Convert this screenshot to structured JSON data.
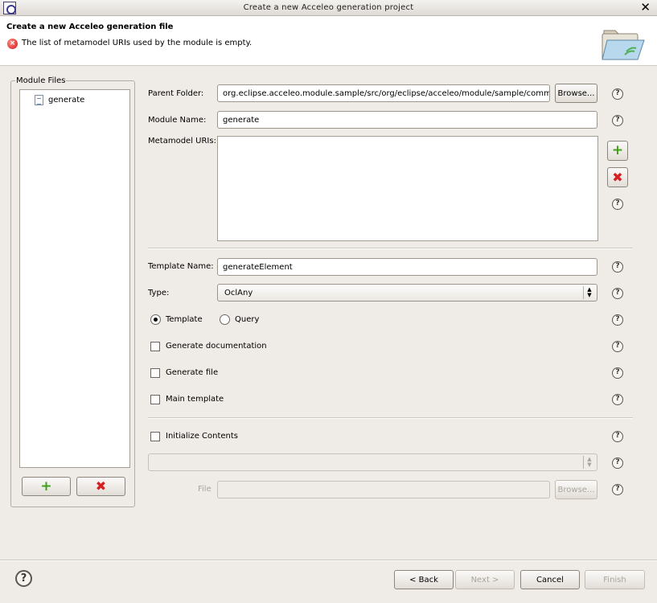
{
  "window": {
    "title": "Create a new Acceleo generation project"
  },
  "banner": {
    "heading": "Create a new Acceleo generation file",
    "error_message": "The list of metamodel URIs used by the module is empty."
  },
  "module_files": {
    "legend": "Module Files",
    "items": [
      {
        "label": "generate"
      }
    ]
  },
  "form": {
    "parent_folder": {
      "label": "Parent Folder:",
      "value": "org.eclipse.acceleo.module.sample/src/org/eclipse/acceleo/module/sample/common",
      "browse_label": "Browse..."
    },
    "module_name": {
      "label": "Module Name:",
      "value": "generate"
    },
    "metamodel_uris": {
      "label": "Metamodel URIs:"
    },
    "template_name": {
      "label": "Template Name:",
      "value": "generateElement"
    },
    "type": {
      "label": "Type:",
      "value": "OclAny"
    },
    "kind": {
      "template_label": "Template",
      "query_label": "Query",
      "selected": "Template"
    },
    "generate_documentation": {
      "label": "Generate documentation",
      "checked": false
    },
    "generate_file": {
      "label": "Generate file",
      "checked": false
    },
    "main_template": {
      "label": "Main template",
      "checked": false
    },
    "initialize_contents": {
      "label": "Initialize Contents",
      "checked": false,
      "combo_value": ""
    },
    "file": {
      "label": "File",
      "value": "",
      "browse_label": "Browse..."
    }
  },
  "buttons": {
    "back": "< Back",
    "next": "Next >",
    "cancel": "Cancel",
    "finish": "Finish"
  },
  "icons": {
    "help": "?",
    "add": "+",
    "remove": "✖",
    "close": "✕"
  },
  "colors": {
    "add": "#3fa018",
    "remove": "#d62020",
    "error": "#d01818"
  }
}
